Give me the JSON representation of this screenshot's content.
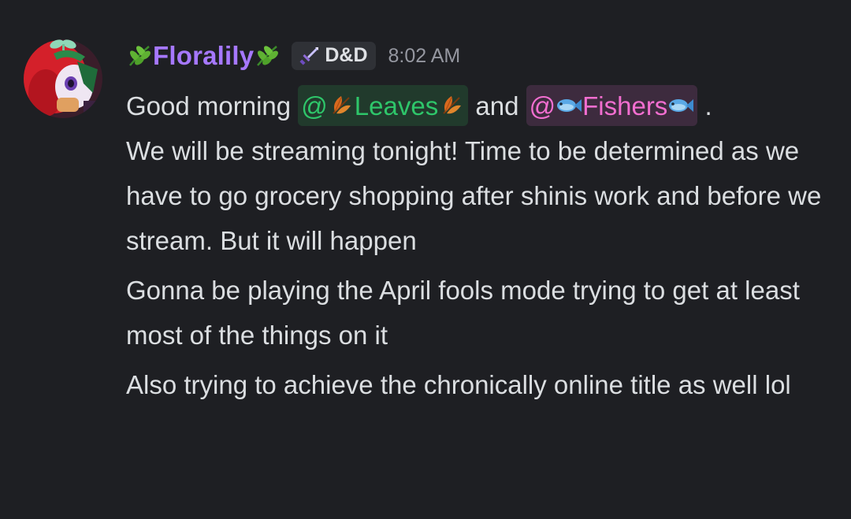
{
  "message": {
    "username": "Floralily",
    "username_color": "#a678ff",
    "username_icon": "herb-icon",
    "tag": {
      "icon": "sword-icon",
      "label": "D&D"
    },
    "timestamp": "8:02 AM",
    "avatar": "avatar-red-hair-character",
    "line1": {
      "greeting": "Good morning ",
      "mention_leaves": {
        "prefix": "@",
        "name": "Leaves",
        "icon": "fallen-leaf-icon",
        "color": "#2ec66a",
        "background": "#213a2c"
      },
      "joiner": " and ",
      "mention_fishers": {
        "prefix": "@",
        "name": "Fishers",
        "icon": "fish-icon",
        "color": "#f26ed0",
        "background": "#3d2b3e"
      },
      "tail": " ."
    },
    "paragraph1_rest": "We will be streaming tonight! Time to be determined as we have to go grocery shopping after shinis work and before we stream. But it will happen",
    "paragraph2": "Gonna be playing the April fools mode trying to get at least most of the things on it",
    "paragraph3": "Also trying to achieve the chronically online title as well lol"
  }
}
